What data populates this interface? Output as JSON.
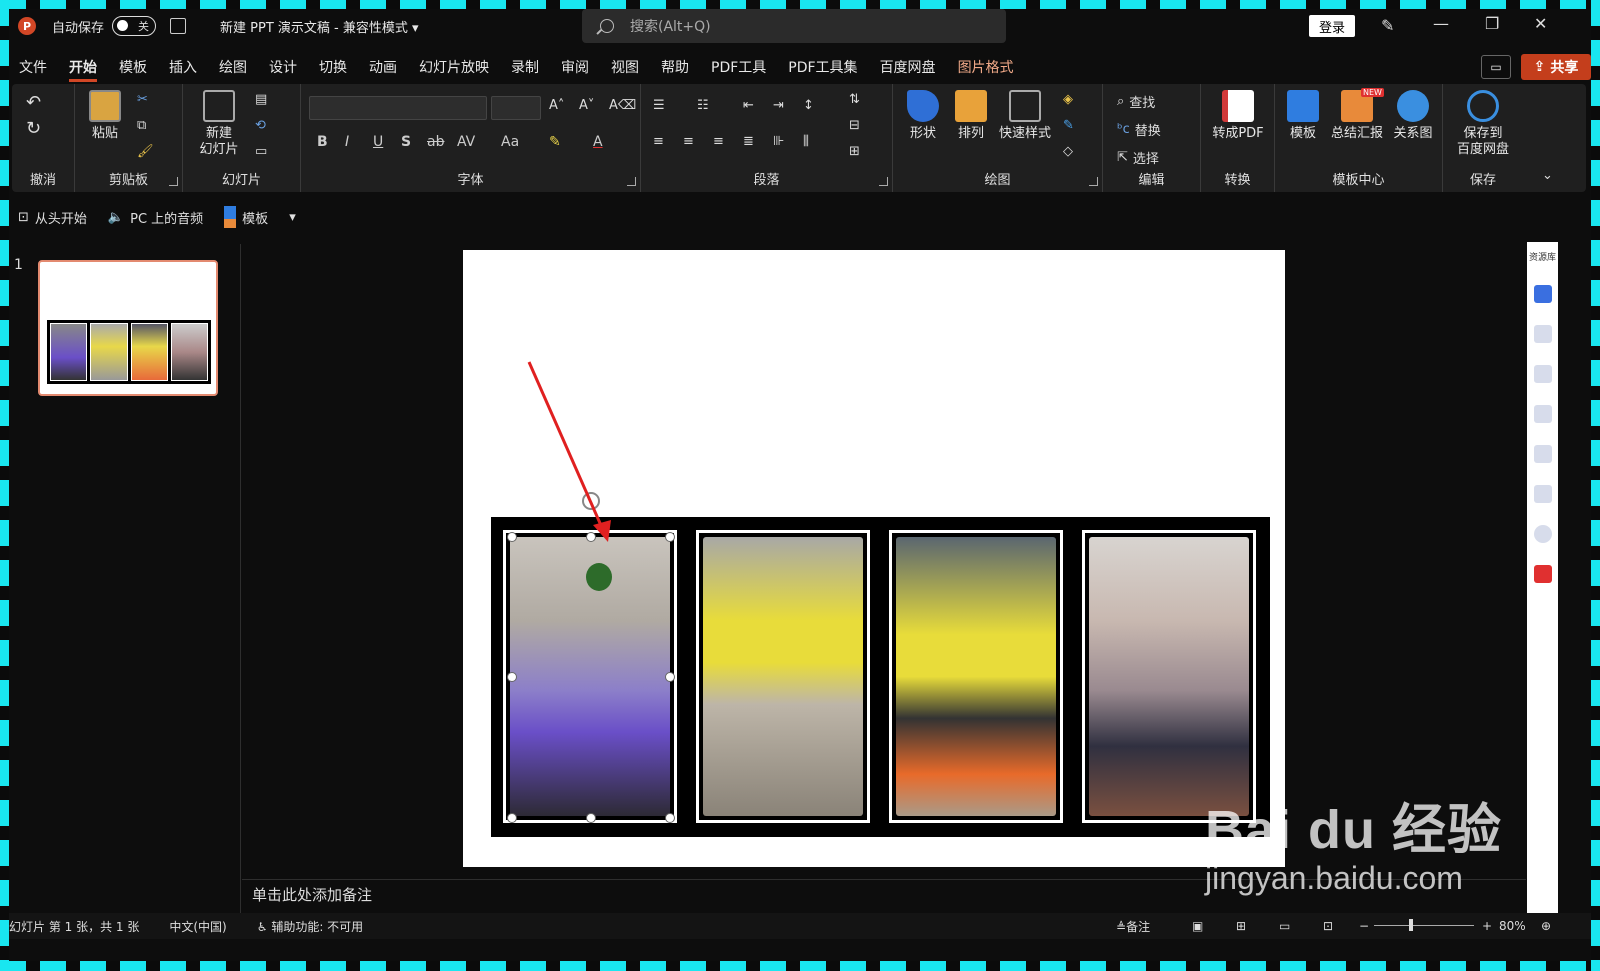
{
  "titlebar": {
    "app_icon": "P",
    "autosave_label": "自动保存",
    "autosave_state": "关",
    "doc_title": "新建 PPT 演示文稿 - 兼容性模式 ▾",
    "search_placeholder": "搜索(Alt+Q)",
    "login_label": "登录",
    "minimize": "—",
    "restore": "❐",
    "close": "✕"
  },
  "menu": {
    "items": [
      "文件",
      "开始",
      "模板",
      "插入",
      "绘图",
      "设计",
      "切换",
      "动画",
      "幻灯片放映",
      "录制",
      "审阅",
      "视图",
      "帮助",
      "PDF工具",
      "PDF工具集",
      "百度网盘",
      "图片格式"
    ],
    "active": "开始",
    "share_label": "共享"
  },
  "ribbon": {
    "groups": {
      "undo": "撤消",
      "clipboard": "剪贴板",
      "slides": "幻灯片",
      "font": "字体",
      "paragraph": "段落",
      "drawing": "绘图",
      "edit": "编辑",
      "convert": "转换",
      "template_center": "模板中心",
      "save": "保存"
    },
    "buttons": {
      "paste": "粘贴",
      "new_slide_line1": "新建",
      "new_slide_line2": "幻灯片",
      "shape": "形状",
      "arrange": "排列",
      "quick_style": "快速样式",
      "find": "查找",
      "replace": "替换",
      "select": "选择",
      "to_pdf": "转成PDF",
      "template": "模板",
      "summary": "总结汇报",
      "relation": "关系图",
      "save_to_line1": "保存到",
      "save_to_line2": "百度网盘",
      "new_badge": "NEW"
    },
    "font_format": [
      "B",
      "I",
      "U",
      "S",
      "ab",
      "AV",
      "Aa"
    ]
  },
  "qat": {
    "from_start": "从头开始",
    "pc_audio": "PC 上的音频",
    "template": "模板"
  },
  "thumbnails": {
    "slide_number": "1"
  },
  "notes": {
    "placeholder": "单击此处添加备注"
  },
  "right_panel": {
    "label": "资源库"
  },
  "status": {
    "slide_info": "幻灯片 第 1 张，共 1 张",
    "language": "中文(中国)",
    "accessibility": "辅助功能: 不可用",
    "notes_btn": "备注",
    "zoom": "80%"
  },
  "watermark": {
    "brand": "Bai du 经验",
    "url": "jingyan.baidu.com"
  },
  "colors": {
    "accent": "#d24726",
    "frame": "#19e6f0",
    "arrow": "#e02020"
  }
}
